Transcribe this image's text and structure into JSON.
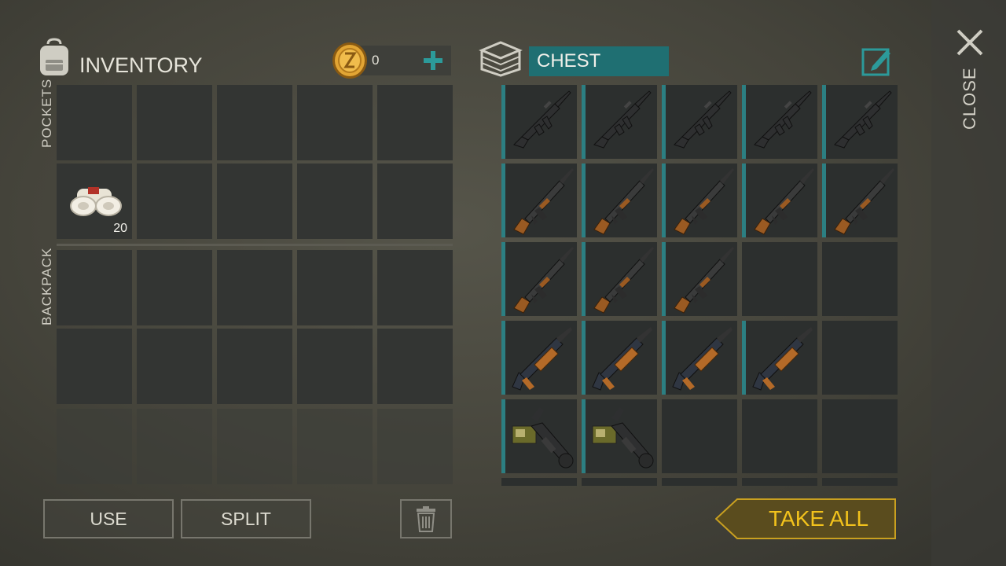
{
  "inventory": {
    "title": "INVENTORY",
    "icon": "backpack-icon",
    "coins": "0",
    "coin_icon": "coin-icon",
    "add_icon": "plus-icon",
    "pockets_label": "POCKETS",
    "backpack_label": "BACKPACK",
    "items": [
      {
        "slot": 5,
        "name": "bandage",
        "icon": "bandage-icon",
        "count": "20"
      }
    ]
  },
  "chest": {
    "title": "CHEST",
    "icon": "chest-icon",
    "edit_icon": "rename-icon",
    "rows": [
      [
        "m4-rifle-icon",
        "m4-rifle-icon",
        "m4-rifle-icon",
        "m4-rifle-icon",
        "m4-rifle-icon"
      ],
      [
        "ak-rifle-icon",
        "ak-rifle-icon",
        "ak-rifle-icon",
        "ak-rifle-icon",
        "ak-rifle-icon"
      ],
      [
        "ak-rifle-icon",
        "ak-rifle-icon",
        "ak-rifle-icon",
        "",
        ""
      ],
      [
        "shotgun-icon",
        "shotgun-icon",
        "shotgun-icon",
        "shotgun-icon",
        ""
      ],
      [
        "grenade-launcher-icon",
        "grenade-launcher-icon",
        "",
        "",
        ""
      ]
    ]
  },
  "buttons": {
    "use": "USE",
    "split": "SPLIT",
    "trash_icon": "trash-icon",
    "take_all": "TAKE ALL",
    "close": "CLOSE",
    "close_icon": "close-icon"
  },
  "colors": {
    "accent_teal": "#2c7f82",
    "take_all_gold": "#c9a020",
    "take_all_text": "#f2c21c"
  }
}
